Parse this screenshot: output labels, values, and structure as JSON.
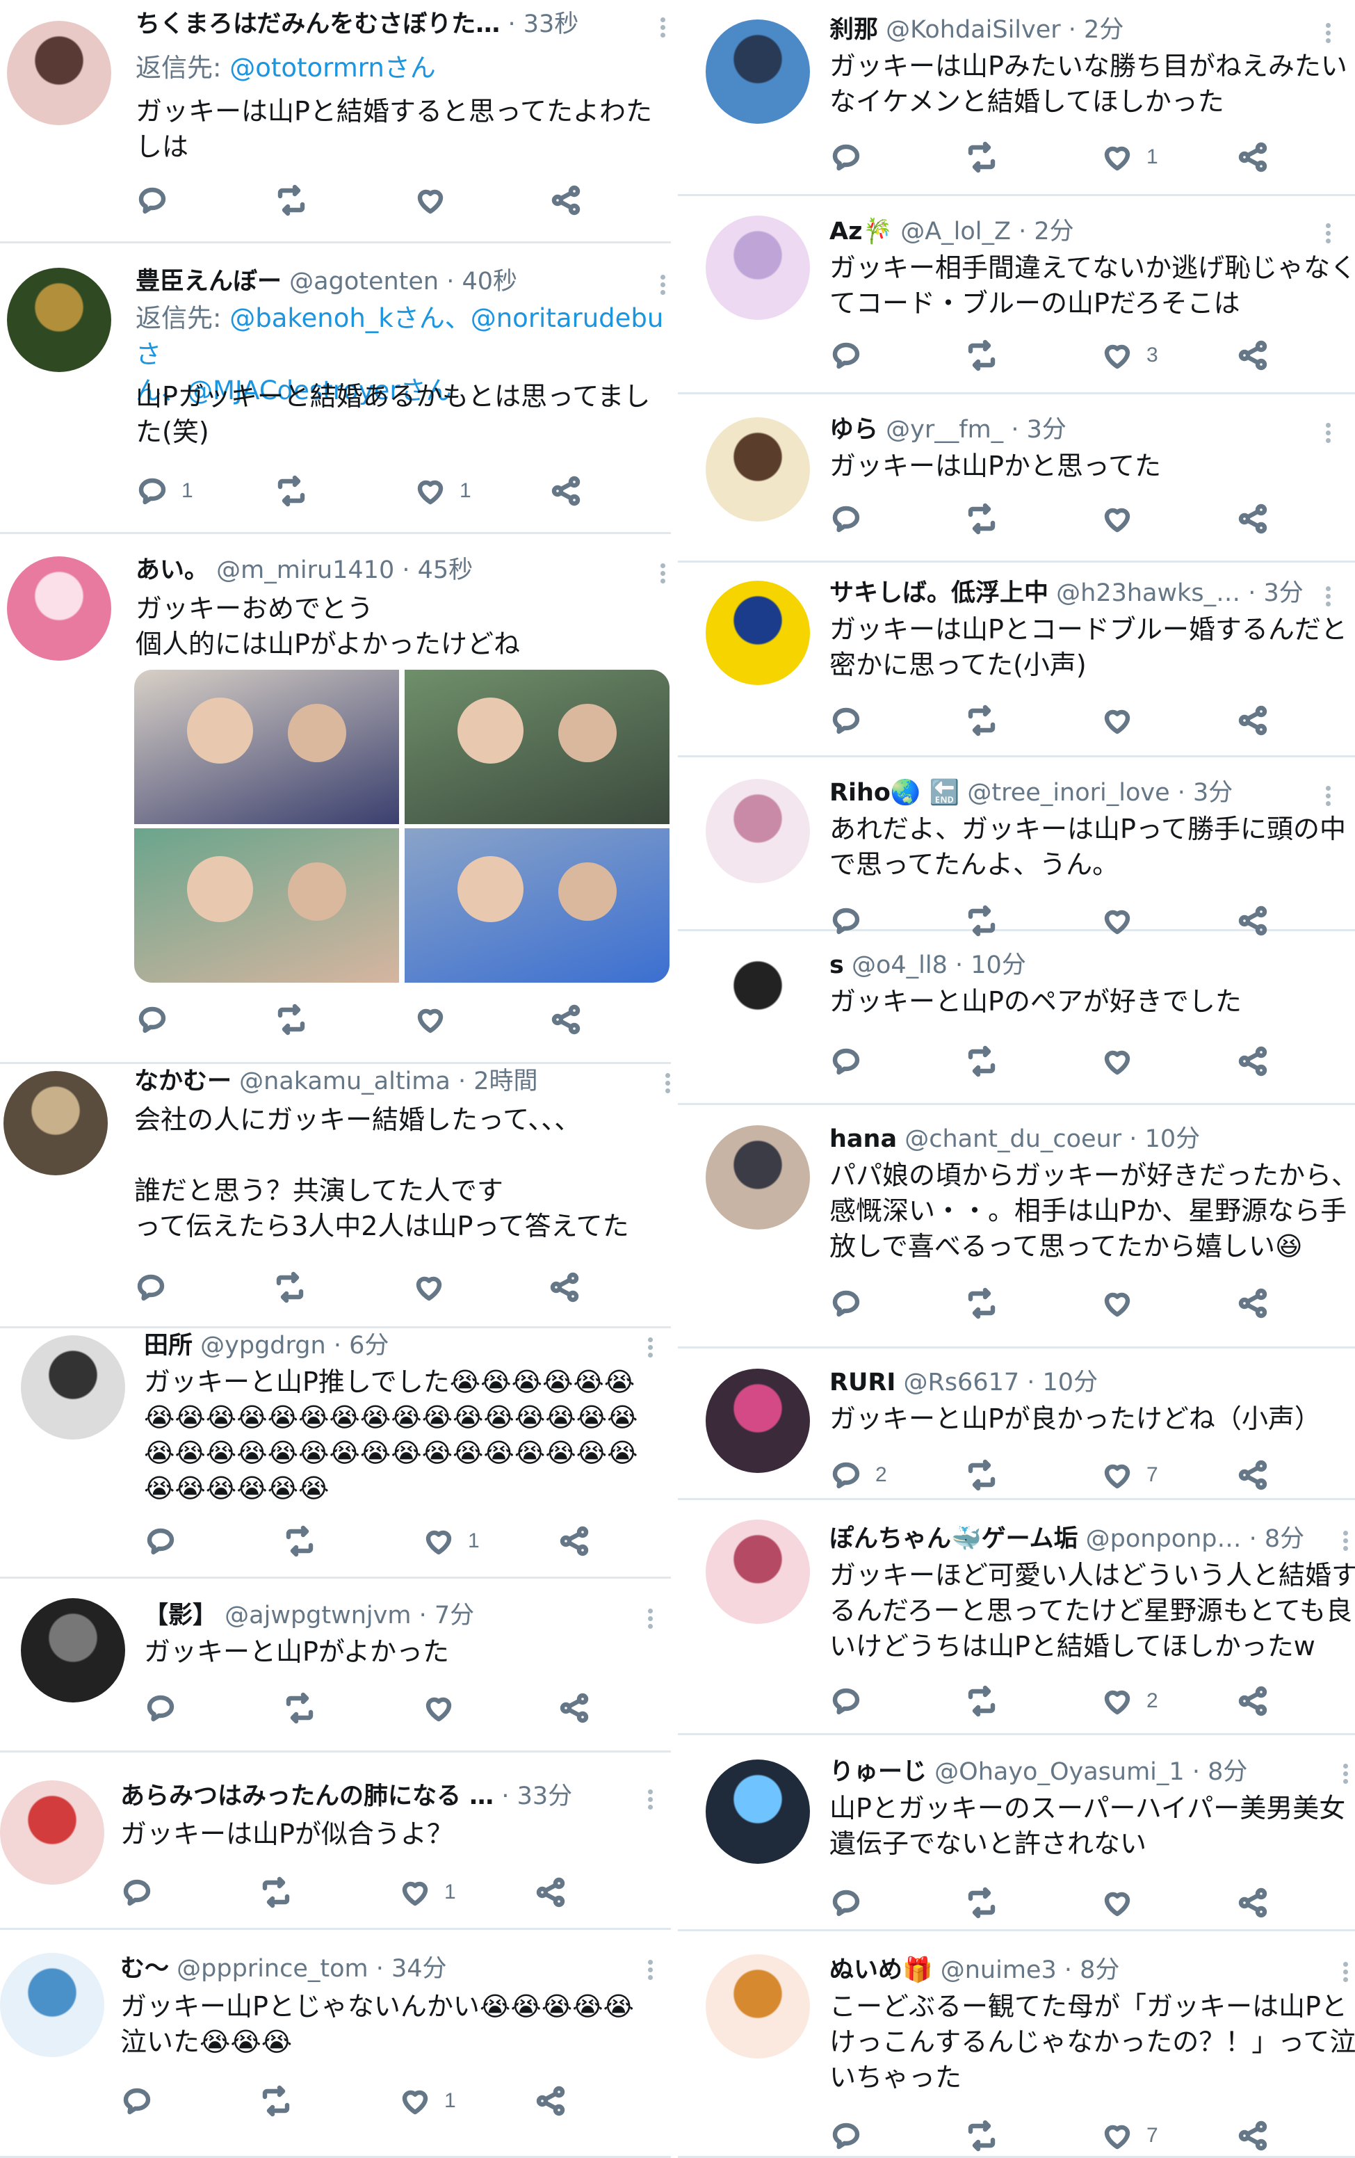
{
  "left": [
    {
      "name": "ちくまろはだみんをむさぼりた…",
      "handle": "",
      "time": "33秒",
      "reply_label": "返信先:",
      "reply_to": "@ototormrnさん",
      "text": [
        "ガッキーは山Pと結婚すると思ってたよわた",
        "しは"
      ],
      "replies": "",
      "likes": ""
    },
    {
      "name": "豊臣えんぼー",
      "handle": "@agotenten",
      "time": "40秒",
      "reply_label": "返信先:",
      "reply_to": "@bakenoh_kさん、@noritarudebuさ",
      "reply_to2": "ん、@MJACdestroyerさん",
      "text": [
        "山Pガッキーと結婚あるかもとは思ってまし",
        "た(笑)"
      ],
      "replies": "1",
      "likes": "1"
    },
    {
      "name": "あい。",
      "handle": "@m_miru1410",
      "time": "45秒",
      "text": [
        "ガッキーおめでとう",
        "個人的には山Pがよかったけどね"
      ],
      "replies": "",
      "likes": ""
    },
    {
      "name": "なかむー",
      "handle": "@nakamu_altima",
      "time": "2時間",
      "text": [
        "会社の人にガッキー結婚したって、、、",
        "",
        "誰だと思う？共演してた人です",
        "って伝えたら3人中2人は山Pって答えてた"
      ],
      "replies": "",
      "likes": ""
    },
    {
      "name": "田所",
      "handle": "@ypgdrgn",
      "time": "6分",
      "text": [
        "ガッキーと山P推しでした😭😭😭😭😭😭",
        "😭😭😭😭😭😭😭😭😭😭😭😭😭😭😭😭",
        "😭😭😭😭😭😭😭😭😭😭😭😭😭😭😭😭",
        "😭😭😭😭😭😭"
      ],
      "replies": "",
      "likes": "1"
    },
    {
      "name": "【影】",
      "handle": "@ajwpgtwnjvm",
      "time": "7分",
      "text": [
        "ガッキーと山Pがよかった"
      ],
      "replies": "",
      "likes": ""
    },
    {
      "name": "あらみつはみったんの肺になる …",
      "handle": "",
      "time": "33分",
      "text": [
        "ガッキーは山Pが似合うよ？"
      ],
      "replies": "",
      "likes": "1"
    },
    {
      "name": "む〜",
      "handle": "@ppprince_tom",
      "time": "34分",
      "text": [
        "ガッキー山Pとじゃないんかい😭😭😭😭😭",
        "泣いた😭😭😭"
      ],
      "replies": "",
      "likes": "1"
    }
  ],
  "right": [
    {
      "name": "刹那",
      "handle": "@KohdaiSilver",
      "time": "2分",
      "text": [
        "ガッキーは山Pみたいな勝ち目がねえみたい",
        "なイケメンと結婚してほしかった"
      ],
      "replies": "",
      "likes": "1"
    },
    {
      "name": "Az🎋",
      "handle": "@A_lol_Z",
      "time": "2分",
      "text": [
        "ガッキー相手間違えてないか逃げ恥じゃなく",
        "てコード・ブルーの山Pだろそこは"
      ],
      "replies": "",
      "likes": "3"
    },
    {
      "name": "ゆら",
      "handle": "@yr__fm_",
      "time": "3分",
      "text": [
        "ガッキーは山Pかと思ってた"
      ],
      "replies": "",
      "likes": ""
    },
    {
      "name": "サキしば。低浮上中",
      "handle": "@h23hawks_…",
      "time": "3分",
      "text": [
        "ガッキーは山Pとコードブルー婚するんだと",
        "密かに思ってた(小声)"
      ],
      "replies": "",
      "likes": ""
    },
    {
      "name": "Riho🌏 🔚",
      "handle": "@tree_inori_love",
      "time": "3分",
      "text": [
        "あれだよ、ガッキーは山Pって勝手に頭の中",
        "で思ってたんよ、うん。"
      ],
      "replies": "",
      "likes": ""
    },
    {
      "name": "s",
      "handle": "@o4_ll8",
      "time": "10分",
      "text": [
        "ガッキーと山Pのペアが好きでした"
      ],
      "replies": "",
      "likes": ""
    },
    {
      "name": "hana",
      "handle": "@chant_du_coeur",
      "time": "10分",
      "text": [
        "パパ娘の頃からガッキーが好きだったから、",
        "感慨深い・・。相手は山Pか、星野源なら手",
        "放しで喜べるって思ってたから嬉しい😆"
      ],
      "replies": "",
      "likes": ""
    },
    {
      "name": "RURI",
      "handle": "@Rs6617",
      "time": "10分",
      "text": [
        "ガッキーと山Pが良かったけどね（小声）"
      ],
      "replies": "2",
      "likes": "7"
    },
    {
      "name": "ぽんちゃん🐳ゲーム垢",
      "handle": "@ponponp…",
      "time": "8分",
      "text": [
        "ガッキーほど可愛い人はどういう人と結婚す",
        "るんだろーと思ってたけど星野源もとても良",
        "いけどうちは山Pと結婚してほしかったw"
      ],
      "replies": "",
      "likes": "2"
    },
    {
      "name": "りゅーじ",
      "handle": "@Ohayo_Oyasumi_1",
      "time": "8分",
      "text": [
        "山Pとガッキーのスーパーハイパー美男美女",
        "遺伝子でないと許されない"
      ],
      "replies": "",
      "likes": ""
    },
    {
      "name": "ぬいめ🎁",
      "handle": "@nuime3",
      "time": "8分",
      "text": [
        "こーどぶるー観てた母が「ガッキーは山Pと",
        "けっこんするんじゃなかったの？！」って泣",
        "いちゃった"
      ],
      "replies": "",
      "likes": "7"
    }
  ],
  "colors": {
    "text": "#14171a",
    "muted": "#657786",
    "link": "#1b95e0",
    "divider": "#e1e8ed",
    "emoji": "#f0a81c"
  },
  "icons": [
    "reply-icon",
    "retweet-icon",
    "like-icon",
    "share-icon",
    "more-icon"
  ]
}
